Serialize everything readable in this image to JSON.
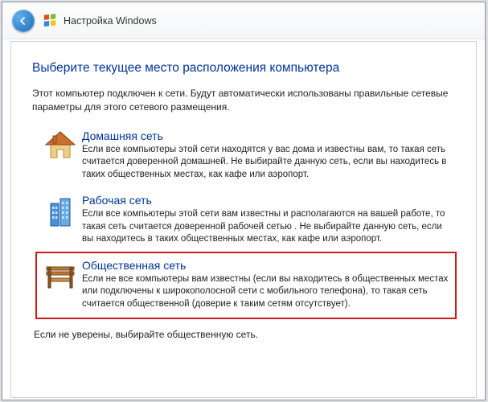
{
  "titlebar": {
    "label": "Настройка Windows"
  },
  "heading": "Выберите текущее место расположения компьютера",
  "intro": "Этот компьютер подключен к сети. Будут автоматически использованы правильные сетевые параметры для этого сетевого размещения.",
  "options": [
    {
      "title": "Домашняя сеть",
      "desc": "Если все компьютеры этой сети находятся у вас дома и известны вам, то такая сеть считается доверенной домашней. Не выбирайте данную сеть, если вы находитесь в таких общественных местах, как кафе или аэропорт."
    },
    {
      "title": "Рабочая сеть",
      "desc": "Если все компьютеры этой сети вам известны и располагаются на вашей работе, то такая сеть считается доверенной рабочей сетью . Не выбирайте данную сеть, если вы находитесь в таких общественных местах, как кафе или аэропорт."
    },
    {
      "title": "Общественная сеть",
      "desc": "Если не все компьютеры вам известны (если вы находитесь в общественных местах или подключены к широкополосной сети с мобильного телефона), то такая сеть считается общественной (доверие к таким сетям отсутствует)."
    }
  ],
  "footer": "Если не уверены, выбирайте общественную сеть."
}
